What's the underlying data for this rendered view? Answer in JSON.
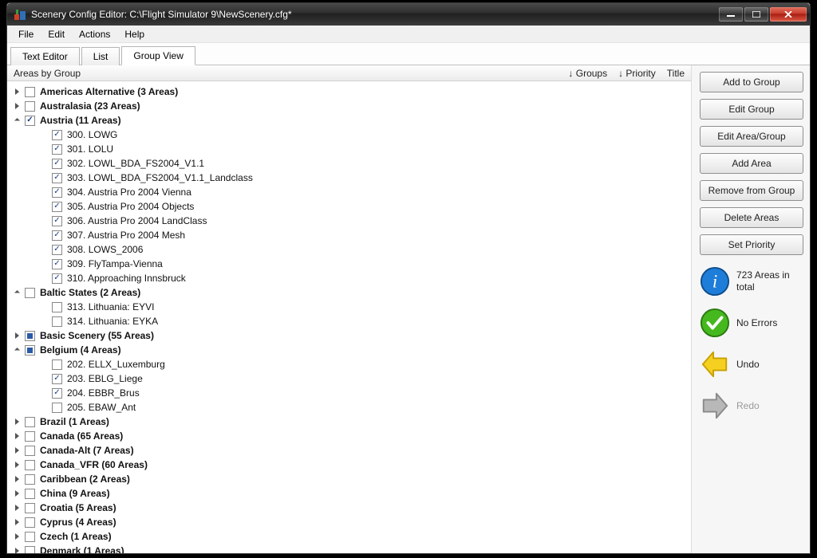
{
  "window_title": "Scenery Config Editor: C:\\Flight Simulator 9\\NewScenery.cfg*",
  "menu": {
    "file": "File",
    "edit": "Edit",
    "actions": "Actions",
    "help": "Help"
  },
  "tabs": {
    "text_editor": "Text Editor",
    "list": "List",
    "group_view": "Group View",
    "active": "group_view"
  },
  "columns": {
    "areas_by_group": "Areas by Group",
    "groups": "↓ Groups",
    "priority": "↓ Priority",
    "title": "Title"
  },
  "buttons": {
    "add_to_group": "Add to Group",
    "edit_group": "Edit Group",
    "edit_area_group": "Edit Area/Group",
    "add_area": "Add Area",
    "remove_from_group": "Remove from Group",
    "delete_areas": "Delete Areas",
    "set_priority": "Set Priority"
  },
  "status": {
    "info_text": "723 Areas in total",
    "ok_text": "No Errors",
    "undo_text": "Undo",
    "redo_text": "Redo"
  },
  "groups": [
    {
      "label": "Americas Alternative (3 Areas)",
      "state": "unchecked",
      "expanded": false,
      "has_children": true
    },
    {
      "label": "Australasia (23 Areas)",
      "state": "unchecked",
      "expanded": false,
      "has_children": true
    },
    {
      "label": "Austria (11 Areas)",
      "state": "checked",
      "expanded": true,
      "has_children": true,
      "children": [
        {
          "label": "300. LOWG",
          "state": "checked"
        },
        {
          "label": "301. LOLU",
          "state": "checked"
        },
        {
          "label": "302. LOWL_BDA_FS2004_V1.1",
          "state": "checked"
        },
        {
          "label": "303. LOWL_BDA_FS2004_V1.1_Landclass",
          "state": "checked"
        },
        {
          "label": "304. Austria Pro 2004 Vienna",
          "state": "checked"
        },
        {
          "label": "305. Austria Pro 2004 Objects",
          "state": "checked"
        },
        {
          "label": "306. Austria Pro 2004 LandClass",
          "state": "checked"
        },
        {
          "label": "307. Austria Pro 2004 Mesh",
          "state": "checked"
        },
        {
          "label": "308. LOWS_2006",
          "state": "checked"
        },
        {
          "label": "309. FlyTampa-Vienna",
          "state": "checked"
        },
        {
          "label": "310. Approaching Innsbruck",
          "state": "checked"
        }
      ]
    },
    {
      "label": "Baltic States (2 Areas)",
      "state": "unchecked",
      "expanded": true,
      "has_children": true,
      "children": [
        {
          "label": "313. Lithuania: EYVI",
          "state": "unchecked"
        },
        {
          "label": "314. Lithuania: EYKA",
          "state": "unchecked"
        }
      ]
    },
    {
      "label": "Basic Scenery (55 Areas)",
      "state": "mixed",
      "expanded": false,
      "has_children": true
    },
    {
      "label": "Belgium (4 Areas)",
      "state": "mixed",
      "expanded": true,
      "has_children": true,
      "children": [
        {
          "label": "202. ELLX_Luxemburg",
          "state": "unchecked"
        },
        {
          "label": "203. EBLG_Liege",
          "state": "checked"
        },
        {
          "label": "204. EBBR_Brus",
          "state": "checked"
        },
        {
          "label": "205. EBAW_Ant",
          "state": "unchecked"
        }
      ]
    },
    {
      "label": "Brazil (1 Areas)",
      "state": "unchecked",
      "expanded": false,
      "has_children": true
    },
    {
      "label": "Canada (65 Areas)",
      "state": "unchecked",
      "expanded": false,
      "has_children": true
    },
    {
      "label": "Canada-Alt (7 Areas)",
      "state": "unchecked",
      "expanded": false,
      "has_children": true
    },
    {
      "label": "Canada_VFR (60 Areas)",
      "state": "unchecked",
      "expanded": false,
      "has_children": true
    },
    {
      "label": "Caribbean (2 Areas)",
      "state": "unchecked",
      "expanded": false,
      "has_children": true
    },
    {
      "label": "China (9 Areas)",
      "state": "unchecked",
      "expanded": false,
      "has_children": true
    },
    {
      "label": "Croatia (5 Areas)",
      "state": "unchecked",
      "expanded": false,
      "has_children": true
    },
    {
      "label": "Cyprus (4 Areas)",
      "state": "unchecked",
      "expanded": false,
      "has_children": true
    },
    {
      "label": "Czech (1 Areas)",
      "state": "unchecked",
      "expanded": false,
      "has_children": true
    },
    {
      "label": "Denmark (1 Areas)",
      "state": "unchecked",
      "expanded": false,
      "has_children": true
    }
  ]
}
